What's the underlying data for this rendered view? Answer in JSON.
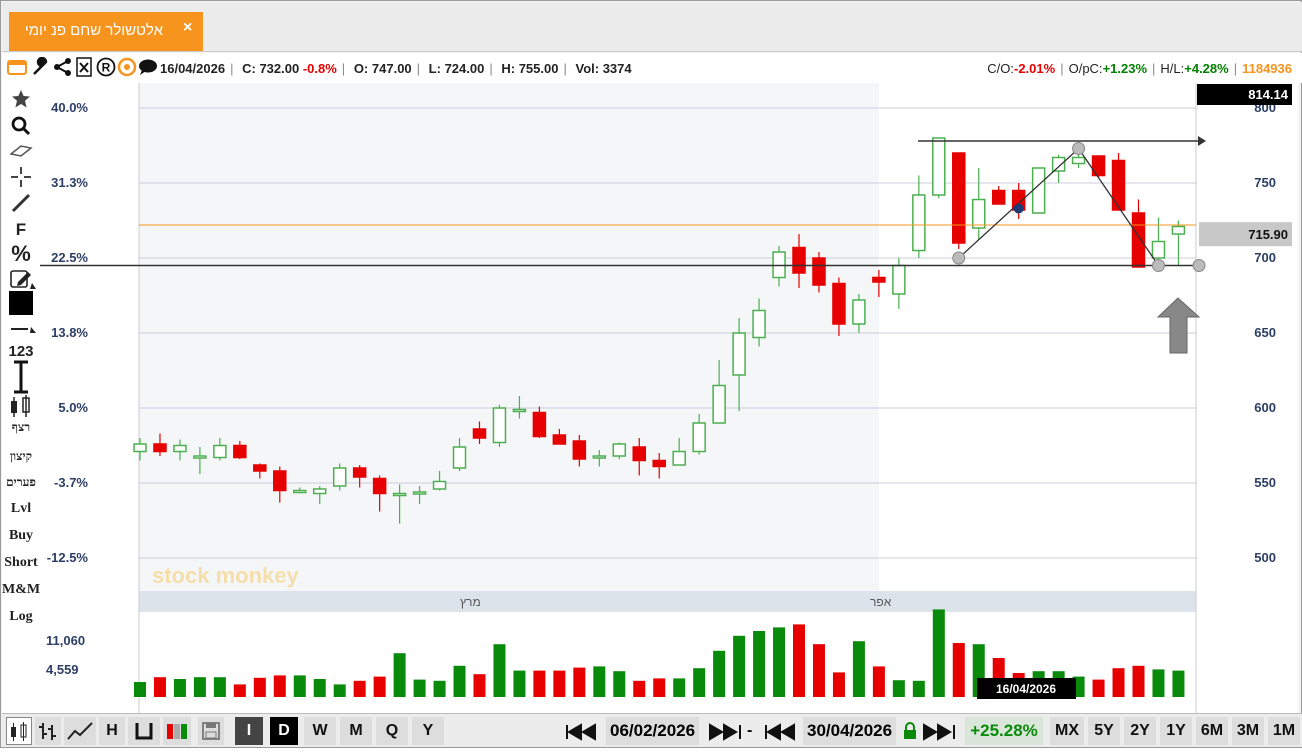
{
  "window": {
    "tab_title": "אלטשולר שחם פנ יומי",
    "close_symbol": "×"
  },
  "info": {
    "date": "16/04/2026",
    "c_label": "C:",
    "c_value": "732.00",
    "c_change": "-0.8%",
    "o_label": "O:",
    "o_value": "747.00",
    "l_label": "L:",
    "l_value": "724.00",
    "h_label": "H:",
    "h_value": "755.00",
    "vol_label": "Vol:",
    "vol_value": "3374",
    "co_label": "C/O:",
    "co_value": "-2.01%",
    "opc_label": "O/pC:",
    "opc_value": "+1.23%",
    "hl_label": "H/L:",
    "hl_value": "+4.28%",
    "id_value": "1184936"
  },
  "left_tools": {
    "text_tool": "F",
    "percent_tool": "%",
    "numbers_tool": "123",
    "r1": "רצף",
    "r2": "קיצון",
    "r3": "פערים",
    "r4": "Lvl",
    "r5": "Buy",
    "r6": "Short",
    "r7": "M&M",
    "r8": "Log"
  },
  "colors": {
    "up": "#4caf50",
    "down": "#e60000",
    "vol_up": "#0a8a0a",
    "vol_down": "#e60000",
    "orange_line": "#f7941d"
  },
  "chart_data": {
    "type": "candlestick",
    "watermark": "stock monkey",
    "months": [
      "מרץ",
      "אפר"
    ],
    "pct_ticks": [
      "40.0%",
      "31.3%",
      "22.5%",
      "13.8%",
      "5.0%",
      "-3.7%",
      "-12.5%"
    ],
    "price_ticks": [
      "800",
      "750",
      "700",
      "650",
      "600",
      "550",
      "500"
    ],
    "ylim": [
      490,
      812
    ],
    "last_price_label": "814.14",
    "current_price_label": "715.90",
    "current_price": 715.9,
    "orange_level": 722,
    "support_level": 695,
    "resistance_level": 778,
    "volume_ticks": [
      "11,060",
      "4,559"
    ],
    "volume_max": 12500,
    "hover_date": "16/04/2026",
    "candles": [
      {
        "o": 571,
        "h": 580,
        "l": 565,
        "c": 576
      },
      {
        "o": 576,
        "h": 583,
        "l": 568,
        "c": 571
      },
      {
        "o": 571,
        "h": 579,
        "l": 565,
        "c": 575
      },
      {
        "o": 568,
        "h": 574,
        "l": 556,
        "c": 568
      },
      {
        "o": 567,
        "h": 580,
        "l": 565,
        "c": 575
      },
      {
        "o": 575,
        "h": 578,
        "l": 566,
        "c": 567
      },
      {
        "o": 562,
        "h": 563,
        "l": 553,
        "c": 558
      },
      {
        "o": 558,
        "h": 561,
        "l": 537,
        "c": 545
      },
      {
        "o": 544,
        "h": 547,
        "l": 543,
        "c": 545
      },
      {
        "o": 543,
        "h": 548,
        "l": 536,
        "c": 546
      },
      {
        "o": 548,
        "h": 563,
        "l": 545,
        "c": 560
      },
      {
        "o": 560,
        "h": 562,
        "l": 547,
        "c": 554
      },
      {
        "o": 553,
        "h": 555,
        "l": 531,
        "c": 543
      },
      {
        "o": 543,
        "h": 549,
        "l": 523,
        "c": 543
      },
      {
        "o": 543,
        "h": 548,
        "l": 536,
        "c": 544
      },
      {
        "o": 546,
        "h": 558,
        "l": 545,
        "c": 551
      },
      {
        "o": 560,
        "h": 580,
        "l": 558,
        "c": 574
      },
      {
        "o": 586,
        "h": 591,
        "l": 576,
        "c": 580
      },
      {
        "o": 577,
        "h": 602,
        "l": 574,
        "c": 600
      },
      {
        "o": 599,
        "h": 608,
        "l": 593,
        "c": 599
      },
      {
        "o": 597,
        "h": 601,
        "l": 580,
        "c": 581
      },
      {
        "o": 582,
        "h": 586,
        "l": 579,
        "c": 576
      },
      {
        "o": 578,
        "h": 582,
        "l": 561,
        "c": 566
      },
      {
        "o": 567,
        "h": 572,
        "l": 561,
        "c": 568
      },
      {
        "o": 568,
        "h": 577,
        "l": 566,
        "c": 576
      },
      {
        "o": 574,
        "h": 580,
        "l": 555,
        "c": 565
      },
      {
        "o": 565,
        "h": 570,
        "l": 553,
        "c": 561
      },
      {
        "o": 562,
        "h": 580,
        "l": 562,
        "c": 571
      },
      {
        "o": 571,
        "h": 596,
        "l": 569,
        "c": 590
      },
      {
        "o": 590,
        "h": 632,
        "l": 590,
        "c": 615
      },
      {
        "o": 622,
        "h": 660,
        "l": 598,
        "c": 650
      },
      {
        "o": 647,
        "h": 673,
        "l": 641,
        "c": 665
      },
      {
        "o": 687,
        "h": 708,
        "l": 681,
        "c": 704
      },
      {
        "o": 707,
        "h": 716,
        "l": 680,
        "c": 690
      },
      {
        "o": 700,
        "h": 704,
        "l": 677,
        "c": 682
      },
      {
        "o": 683,
        "h": 687,
        "l": 648,
        "c": 656
      },
      {
        "o": 656,
        "h": 676,
        "l": 650,
        "c": 672
      },
      {
        "o": 687,
        "h": 692,
        "l": 674,
        "c": 684
      },
      {
        "o": 676,
        "h": 700,
        "l": 666,
        "c": 695
      },
      {
        "o": 705,
        "h": 755,
        "l": 700,
        "c": 742
      },
      {
        "o": 742,
        "h": 780,
        "l": 740,
        "c": 780
      },
      {
        "o": 770,
        "h": 770,
        "l": 706,
        "c": 710
      },
      {
        "o": 720,
        "h": 760,
        "l": 712,
        "c": 739
      },
      {
        "o": 745,
        "h": 748,
        "l": 737,
        "c": 736
      },
      {
        "o": 745,
        "h": 750,
        "l": 726,
        "c": 732
      },
      {
        "o": 730,
        "h": 759,
        "l": 730,
        "c": 760
      },
      {
        "o": 758,
        "h": 769,
        "l": 750,
        "c": 767
      },
      {
        "o": 763,
        "h": 770,
        "l": 760,
        "c": 767
      },
      {
        "o": 768,
        "h": 768,
        "l": 754,
        "c": 755
      },
      {
        "o": 765,
        "h": 770,
        "l": 733,
        "c": 732
      },
      {
        "o": 730,
        "h": 739,
        "l": 694,
        "c": 694
      },
      {
        "o": 700,
        "h": 727,
        "l": 696,
        "c": 711
      },
      {
        "o": 716,
        "h": 725,
        "l": 695,
        "c": 721
      }
    ],
    "volumes": [
      2500,
      3300,
      3000,
      3300,
      3300,
      2100,
      3200,
      3600,
      3600,
      3000,
      2100,
      2700,
      3400,
      7300,
      2900,
      2700,
      5200,
      3800,
      8800,
      4400,
      4400,
      4400,
      4900,
      5100,
      4300,
      2700,
      3100,
      3100,
      4800,
      7700,
      10200,
      11000,
      11600,
      12100,
      8800,
      4100,
      9300,
      5100,
      2800,
      2700,
      14600,
      9000,
      8800,
      6500,
      4000,
      4300,
      4300,
      3400,
      2900,
      4800,
      5200,
      4600,
      4400
    ]
  },
  "bottom": {
    "i_btn": "I",
    "d_btn": "D",
    "w_btn": "W",
    "m_btn": "M",
    "q_btn": "Q",
    "y_btn": "Y",
    "h_btn": "H",
    "from_date": "06/02/2026",
    "to_date": "30/04/2026",
    "dash": "-",
    "change_pct": "+25.28%",
    "mx": "MX",
    "y5": "5Y",
    "y2": "2Y",
    "y1": "1Y",
    "m6": "6M",
    "m3": "3M",
    "m1": "1M"
  }
}
